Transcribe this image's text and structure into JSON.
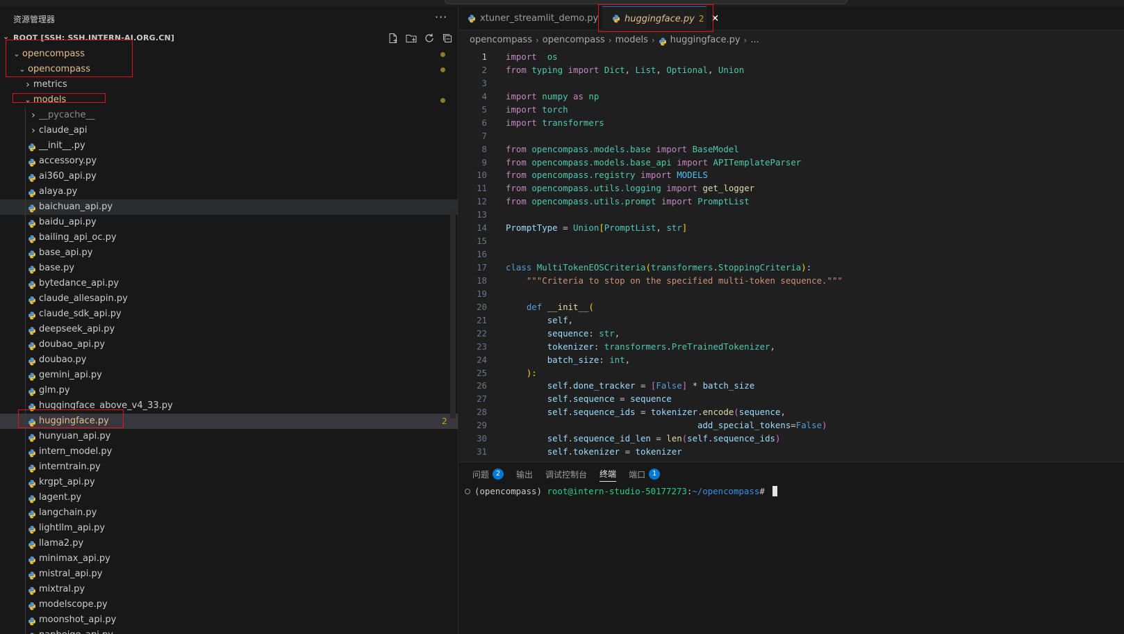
{
  "sidebar": {
    "title": "资源管理器",
    "more": "···",
    "root_label": "ROOT [SSH: SSH.INTERN-AI.ORG.CN]",
    "tree": [
      {
        "label": "opencompass",
        "depth": 0,
        "type": "folder",
        "open": true,
        "modified": true
      },
      {
        "label": "opencompass",
        "depth": 1,
        "type": "folder",
        "open": true,
        "modified": true
      },
      {
        "label": "metrics",
        "depth": 2,
        "type": "folder",
        "open": false
      },
      {
        "label": "models",
        "depth": 2,
        "type": "folder",
        "open": true,
        "modified": true
      },
      {
        "label": "__pycache__",
        "depth": 3,
        "type": "folder",
        "open": false,
        "dim": true
      },
      {
        "label": "claude_api",
        "depth": 3,
        "type": "folder",
        "open": false
      },
      {
        "label": "__init__.py",
        "depth": 3,
        "type": "file"
      },
      {
        "label": "accessory.py",
        "depth": 3,
        "type": "file"
      },
      {
        "label": "ai360_api.py",
        "depth": 3,
        "type": "file"
      },
      {
        "label": "alaya.py",
        "depth": 3,
        "type": "file"
      },
      {
        "label": "baichuan_api.py",
        "depth": 3,
        "type": "file",
        "hover": true
      },
      {
        "label": "baidu_api.py",
        "depth": 3,
        "type": "file"
      },
      {
        "label": "bailing_api_oc.py",
        "depth": 3,
        "type": "file"
      },
      {
        "label": "base_api.py",
        "depth": 3,
        "type": "file"
      },
      {
        "label": "base.py",
        "depth": 3,
        "type": "file"
      },
      {
        "label": "bytedance_api.py",
        "depth": 3,
        "type": "file"
      },
      {
        "label": "claude_allesapin.py",
        "depth": 3,
        "type": "file"
      },
      {
        "label": "claude_sdk_api.py",
        "depth": 3,
        "type": "file"
      },
      {
        "label": "deepseek_api.py",
        "depth": 3,
        "type": "file"
      },
      {
        "label": "doubao_api.py",
        "depth": 3,
        "type": "file"
      },
      {
        "label": "doubao.py",
        "depth": 3,
        "type": "file"
      },
      {
        "label": "gemini_api.py",
        "depth": 3,
        "type": "file"
      },
      {
        "label": "glm.py",
        "depth": 3,
        "type": "file"
      },
      {
        "label": "huggingface_above_v4_33.py",
        "depth": 3,
        "type": "file"
      },
      {
        "label": "huggingface.py",
        "depth": 3,
        "type": "file",
        "selected": true,
        "modified": true,
        "count": "2"
      },
      {
        "label": "hunyuan_api.py",
        "depth": 3,
        "type": "file"
      },
      {
        "label": "intern_model.py",
        "depth": 3,
        "type": "file"
      },
      {
        "label": "interntrain.py",
        "depth": 3,
        "type": "file"
      },
      {
        "label": "krgpt_api.py",
        "depth": 3,
        "type": "file"
      },
      {
        "label": "lagent.py",
        "depth": 3,
        "type": "file"
      },
      {
        "label": "langchain.py",
        "depth": 3,
        "type": "file"
      },
      {
        "label": "lightllm_api.py",
        "depth": 3,
        "type": "file"
      },
      {
        "label": "llama2.py",
        "depth": 3,
        "type": "file"
      },
      {
        "label": "minimax_api.py",
        "depth": 3,
        "type": "file"
      },
      {
        "label": "mistral_api.py",
        "depth": 3,
        "type": "file"
      },
      {
        "label": "mixtral.py",
        "depth": 3,
        "type": "file"
      },
      {
        "label": "modelscope.py",
        "depth": 3,
        "type": "file"
      },
      {
        "label": "moonshot_api.py",
        "depth": 3,
        "type": "file"
      },
      {
        "label": "nanbeige_api.py",
        "depth": 3,
        "type": "file"
      }
    ]
  },
  "tabs": [
    {
      "label": "xtuner_streamlit_demo.py"
    },
    {
      "label": "huggingface.py",
      "count": "2",
      "close": "✕"
    }
  ],
  "breadcrumbs": [
    "opencompass",
    "opencompass",
    "models",
    "huggingface.py",
    "..."
  ],
  "code": [
    [
      [
        "k",
        "import"
      ],
      [
        "",
        "  "
      ],
      [
        "m",
        "os"
      ]
    ],
    [
      [
        "k",
        "from"
      ],
      [
        "",
        " "
      ],
      [
        "m",
        "typing"
      ],
      [
        "",
        " "
      ],
      [
        "k",
        "import"
      ],
      [
        "",
        " "
      ],
      [
        "m",
        "Dict"
      ],
      [
        "",
        ", "
      ],
      [
        "m",
        "List"
      ],
      [
        "",
        ", "
      ],
      [
        "m",
        "Optional"
      ],
      [
        "",
        ", "
      ],
      [
        "m",
        "Union"
      ]
    ],
    [],
    [
      [
        "k",
        "import"
      ],
      [
        "",
        " "
      ],
      [
        "m",
        "numpy"
      ],
      [
        "",
        " "
      ],
      [
        "k",
        "as"
      ],
      [
        "",
        " "
      ],
      [
        "m",
        "np"
      ]
    ],
    [
      [
        "k",
        "import"
      ],
      [
        "",
        " "
      ],
      [
        "m",
        "torch"
      ]
    ],
    [
      [
        "k",
        "import"
      ],
      [
        "",
        " "
      ],
      [
        "m",
        "transformers"
      ]
    ],
    [],
    [
      [
        "k",
        "from"
      ],
      [
        "",
        " "
      ],
      [
        "m",
        "opencompass.models.base"
      ],
      [
        "",
        " "
      ],
      [
        "k",
        "import"
      ],
      [
        "",
        " "
      ],
      [
        "m",
        "BaseModel"
      ]
    ],
    [
      [
        "k",
        "from"
      ],
      [
        "",
        " "
      ],
      [
        "m",
        "opencompass.models.base_api"
      ],
      [
        "",
        " "
      ],
      [
        "k",
        "import"
      ],
      [
        "",
        " "
      ],
      [
        "m",
        "APITemplateParser"
      ]
    ],
    [
      [
        "k",
        "from"
      ],
      [
        "",
        " "
      ],
      [
        "m",
        "opencompass.registry"
      ],
      [
        "",
        " "
      ],
      [
        "k",
        "import"
      ],
      [
        "",
        " "
      ],
      [
        "c",
        "MODELS"
      ]
    ],
    [
      [
        "k",
        "from"
      ],
      [
        "",
        " "
      ],
      [
        "m",
        "opencompass.utils.logging"
      ],
      [
        "",
        " "
      ],
      [
        "k",
        "import"
      ],
      [
        "",
        " "
      ],
      [
        "f",
        "get_logger"
      ]
    ],
    [
      [
        "k",
        "from"
      ],
      [
        "",
        " "
      ],
      [
        "m",
        "opencompass.utils.prompt"
      ],
      [
        "",
        " "
      ],
      [
        "k",
        "import"
      ],
      [
        "",
        " "
      ],
      [
        "m",
        "PromptList"
      ]
    ],
    [],
    [
      [
        "v",
        "PromptType"
      ],
      [
        "",
        " = "
      ],
      [
        "m",
        "Union"
      ],
      [
        "y",
        "["
      ],
      [
        "m",
        "PromptList"
      ],
      [
        "",
        ", "
      ],
      [
        "m",
        "str"
      ],
      [
        "y",
        "]"
      ]
    ],
    [],
    [],
    [
      [
        "kb",
        "class"
      ],
      [
        "",
        " "
      ],
      [
        "m",
        "MultiTokenEOSCriteria"
      ],
      [
        "y",
        "("
      ],
      [
        "m",
        "transformers"
      ],
      [
        "",
        "."
      ],
      [
        "m",
        "StoppingCriteria"
      ],
      [
        "y",
        ")"
      ],
      [
        "",
        ":"
      ]
    ],
    [
      [
        "",
        "    "
      ],
      [
        "s",
        "\"\"\"Criteria to stop on the specified multi-token sequence.\"\"\""
      ]
    ],
    [],
    [
      [
        "",
        "    "
      ],
      [
        "kb",
        "def"
      ],
      [
        "",
        " "
      ],
      [
        "f",
        "__init__"
      ],
      [
        "y",
        "("
      ]
    ],
    [
      [
        "",
        "        "
      ],
      [
        "v",
        "self"
      ],
      [
        "",
        ","
      ]
    ],
    [
      [
        "",
        "        "
      ],
      [
        "v",
        "sequence"
      ],
      [
        "",
        ": "
      ],
      [
        "m",
        "str"
      ],
      [
        "",
        ","
      ]
    ],
    [
      [
        "",
        "        "
      ],
      [
        "v",
        "tokenizer"
      ],
      [
        "",
        ": "
      ],
      [
        "m",
        "transformers"
      ],
      [
        "",
        "."
      ],
      [
        "m",
        "PreTrainedTokenizer"
      ],
      [
        "",
        ","
      ]
    ],
    [
      [
        "",
        "        "
      ],
      [
        "v",
        "batch_size"
      ],
      [
        "",
        ": "
      ],
      [
        "m",
        "int"
      ],
      [
        "",
        ","
      ]
    ],
    [
      [
        "",
        "    "
      ],
      [
        "y",
        "):"
      ]
    ],
    [
      [
        "",
        "        "
      ],
      [
        "v",
        "self"
      ],
      [
        "",
        "."
      ],
      [
        "v",
        "done_tracker"
      ],
      [
        "",
        " = "
      ],
      [
        "p",
        "["
      ],
      [
        "kb",
        "False"
      ],
      [
        "p",
        "]"
      ],
      [
        "",
        " * "
      ],
      [
        "v",
        "batch_size"
      ]
    ],
    [
      [
        "",
        "        "
      ],
      [
        "v",
        "self"
      ],
      [
        "",
        "."
      ],
      [
        "v",
        "sequence"
      ],
      [
        "",
        " = "
      ],
      [
        "v",
        "sequence"
      ]
    ],
    [
      [
        "",
        "        "
      ],
      [
        "v",
        "self"
      ],
      [
        "",
        "."
      ],
      [
        "v",
        "sequence_ids"
      ],
      [
        "",
        " = "
      ],
      [
        "v",
        "tokenizer"
      ],
      [
        "",
        "."
      ],
      [
        "f",
        "encode"
      ],
      [
        "p",
        "("
      ],
      [
        "v",
        "sequence"
      ],
      [
        "",
        ","
      ]
    ],
    [
      [
        "",
        "                                     "
      ],
      [
        "v",
        "add_special_tokens"
      ],
      [
        "",
        "="
      ],
      [
        "kb",
        "False"
      ],
      [
        "p",
        ")"
      ]
    ],
    [
      [
        "",
        "        "
      ],
      [
        "v",
        "self"
      ],
      [
        "",
        "."
      ],
      [
        "v",
        "sequence_id_len"
      ],
      [
        "",
        " = "
      ],
      [
        "f",
        "len"
      ],
      [
        "p",
        "("
      ],
      [
        "v",
        "self"
      ],
      [
        "",
        "."
      ],
      [
        "v",
        "sequence_ids"
      ],
      [
        "p",
        ")"
      ]
    ],
    [
      [
        "",
        "        "
      ],
      [
        "v",
        "self"
      ],
      [
        "",
        "."
      ],
      [
        "v",
        "tokenizer"
      ],
      [
        "",
        " = "
      ],
      [
        "v",
        "tokenizer"
      ]
    ],
    []
  ],
  "panel": {
    "tabs": [
      {
        "label": "问题",
        "badge": "2"
      },
      {
        "label": "输出"
      },
      {
        "label": "调试控制台"
      },
      {
        "label": "终端",
        "active": true
      },
      {
        "label": "端口",
        "badge": "1"
      }
    ],
    "terminal": {
      "env": "(opencompass) ",
      "user": "root@intern-studio-50177273",
      "sep": ":",
      "path": "~/opencompass",
      "prompt": "# "
    }
  },
  "colors": {
    "accent": "#0078d4",
    "modified": "#e2c08d",
    "annotation": "#e8111b"
  },
  "icons": [
    "new-file-icon",
    "new-folder-icon",
    "refresh-icon",
    "collapse-all-icon",
    "python-file-icon",
    "close-icon",
    "chevron-right-icon",
    "chevron-down-icon"
  ]
}
